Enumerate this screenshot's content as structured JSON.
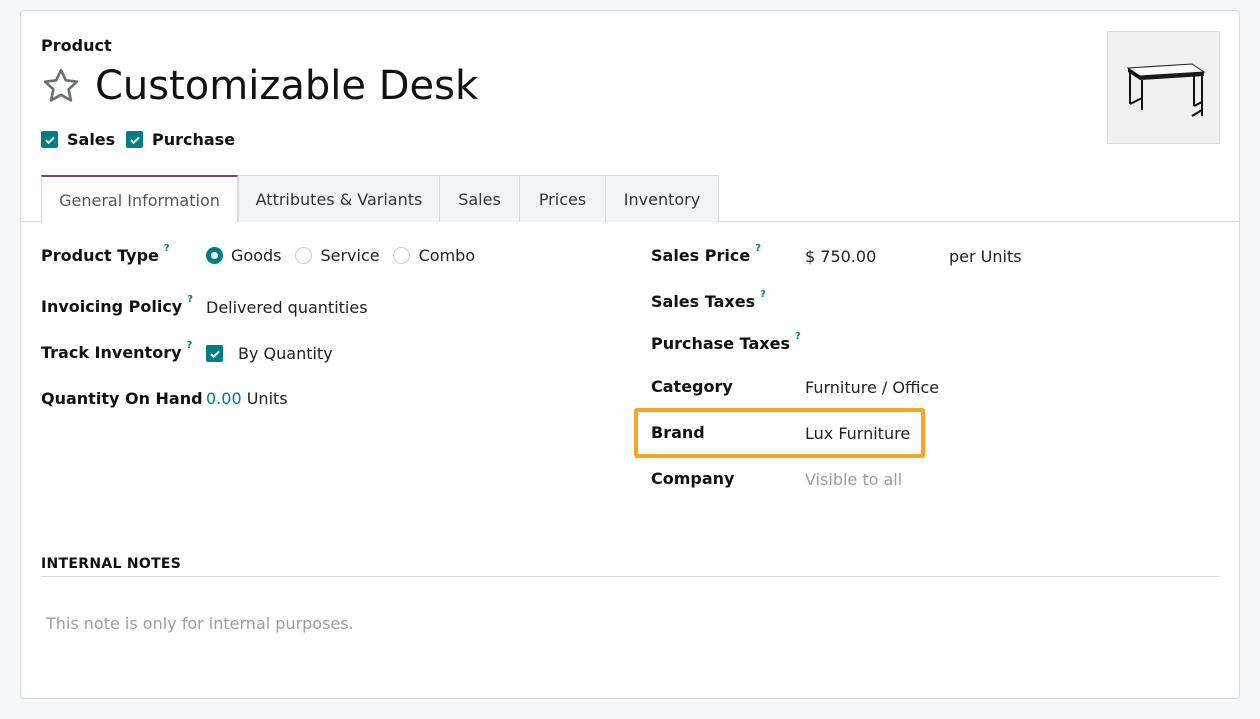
{
  "header": {
    "model_label": "Product",
    "title": "Customizable Desk",
    "flags": [
      {
        "label": "Sales",
        "checked": true
      },
      {
        "label": "Purchase",
        "checked": true
      }
    ]
  },
  "tabs": [
    {
      "label": "General Information",
      "active": true
    },
    {
      "label": "Attributes & Variants",
      "active": false
    },
    {
      "label": "Sales",
      "active": false
    },
    {
      "label": "Prices",
      "active": false
    },
    {
      "label": "Inventory",
      "active": false
    }
  ],
  "left": {
    "product_type": {
      "label": "Product Type",
      "help": "?",
      "options": [
        "Goods",
        "Service",
        "Combo"
      ],
      "selected": "Goods"
    },
    "invoicing_policy": {
      "label": "Invoicing Policy",
      "help": "?",
      "value": "Delivered quantities"
    },
    "track_inventory": {
      "label": "Track Inventory",
      "help": "?",
      "value": "By Quantity",
      "checked": true
    },
    "qty_on_hand": {
      "label": "Quantity On Hand",
      "amount": "0.00",
      "unit": "Units"
    }
  },
  "right": {
    "sales_price": {
      "label": "Sales Price",
      "help": "?",
      "value": "$ 750.00",
      "unit": "per Units"
    },
    "sales_taxes": {
      "label": "Sales Taxes",
      "help": "?"
    },
    "purchase_taxes": {
      "label": "Purchase Taxes",
      "help": "?"
    },
    "category": {
      "label": "Category",
      "value": "Furniture / Office"
    },
    "brand": {
      "label": "Brand",
      "value": "Lux Furniture"
    },
    "company": {
      "label": "Company",
      "placeholder": "Visible to all"
    }
  },
  "notes": {
    "title": "INTERNAL NOTES",
    "placeholder": "This note is only for internal purposes."
  },
  "colors": {
    "accent": "#017e84",
    "tab_active": "#714b67",
    "highlight": "#f6a623"
  }
}
